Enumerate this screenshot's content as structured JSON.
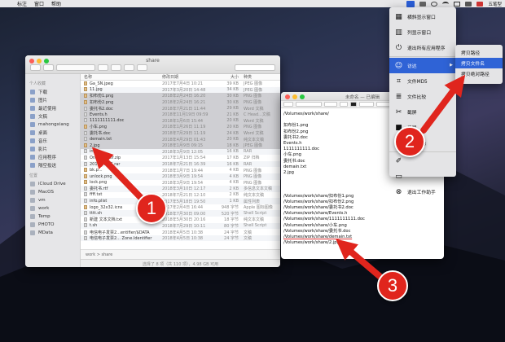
{
  "menubar": {
    "items": [
      "",
      "标注",
      "窗口",
      "帮助"
    ],
    "tray_text": "五笔型"
  },
  "finder": {
    "title": "share",
    "sidebar": {
      "favorites_head": "个人收藏",
      "favorites": [
        "下载",
        "图片",
        "最近使用",
        "文稿",
        "mahongxiang",
        "桌面",
        "音乐",
        "影片",
        "应用程序",
        "隔空投送"
      ],
      "locations_head": "位置",
      "locations": [
        "iCloud Drive",
        "MacOS",
        "vm",
        "work",
        "Temp",
        "PHOTO",
        "MData"
      ]
    },
    "columns": {
      "name": "名称",
      "date": "修改日期",
      "size": "大小",
      "kind": "种类"
    },
    "rows": [
      {
        "name": "Ga_SN.jpeg",
        "date": "2017年7月4日 10:21",
        "size": "39 KB",
        "kind": "JPEG 图像",
        "icon": "img"
      },
      {
        "name": "11.jpg",
        "date": "2017年3月20日 14:48",
        "size": "34 KB",
        "kind": "JPEG 图像",
        "icon": "img"
      },
      {
        "name": "扣布份1.png",
        "date": "2018年2月24日 16:20",
        "size": "30 KB",
        "kind": "PNG 图像",
        "icon": "img"
      },
      {
        "name": "扣布份2.png",
        "date": "2018年2月24日 16:21",
        "size": "30 KB",
        "kind": "PNG 图像",
        "icon": "img"
      },
      {
        "name": "委托书2.doc",
        "date": "2018年7月21日 11:44",
        "size": "29 KB",
        "kind": "Word 文稿",
        "icon": "doc"
      },
      {
        "name": "Events.h",
        "date": "2018年11月19日 09:59",
        "size": "21 KB",
        "kind": "C Head...文稿",
        "icon": "doc"
      },
      {
        "name": "1111111111.doc",
        "date": "2018年1月6日 15:44",
        "size": "20 KB",
        "kind": "Word 文稿",
        "icon": "doc"
      },
      {
        "name": "小车.png",
        "date": "2018年1月26日 11:19",
        "size": "20 KB",
        "kind": "PNG 图像",
        "icon": "img"
      },
      {
        "name": "委托书.doc",
        "date": "2018年7月29日 11:19",
        "size": "24 KB",
        "kind": "Word 文稿",
        "icon": "doc"
      },
      {
        "name": "demain.txt",
        "date": "2018年4月29日 01:43",
        "size": "20 KB",
        "kind": "纯文本文稿",
        "icon": "doc"
      },
      {
        "name": "2.jpg",
        "date": "2018年1月9日 09:15",
        "size": "18 KB",
        "kind": "JPEG 图像",
        "icon": "img"
      },
      {
        "name": "inpu...",
        "date": "2018年3月9日 12:05",
        "size": "16 KB",
        "kind": "RAR",
        "icon": "doc"
      },
      {
        "name": "Ori...master.zip",
        "date": "2017年1月13日 15:54",
        "size": "17 KB",
        "kind": "ZIP 归档",
        "icon": "doc"
      },
      {
        "name": "201...7.876.rar",
        "date": "2018年7月21日 16:39",
        "size": "16 KB",
        "kind": "RAR",
        "icon": "doc"
      },
      {
        "name": "bk.p...",
        "date": "2018年1月7日 19:44",
        "size": "4 KB",
        "kind": "PNG 图像",
        "icon": "img"
      },
      {
        "name": "unlock.png",
        "date": "2018年3月9日 19:54",
        "size": "4 KB",
        "kind": "PNG 图像",
        "icon": "img"
      },
      {
        "name": "lock.png",
        "date": "2018年3月9日 19:54",
        "size": "4 KB",
        "kind": "PNG 图像",
        "icon": "img"
      },
      {
        "name": "委托书.rtf",
        "date": "2018年3月10日 12:17",
        "size": "2 KB",
        "kind": "多信息文本文稿",
        "icon": "doc"
      },
      {
        "name": "ffff.txt",
        "date": "2018年7月21日 12:10",
        "size": "2 KB",
        "kind": "纯文本文稿",
        "icon": "doc"
      },
      {
        "name": "info.plist",
        "date": "2017年5月18日 19:50",
        "size": "1 KB",
        "kind": "属性列表",
        "icon": "doc"
      },
      {
        "name": "logo_32x32.icns",
        "date": "2017年2月4日 16:44",
        "size": "948 字节",
        "kind": "Apple 图标图像",
        "icon": "img"
      },
      {
        "name": "tttt.sh",
        "date": "2018年7月30日 09:00",
        "size": "520 字节",
        "kind": "Shell Script",
        "icon": "doc"
      },
      {
        "name": "新建 文本文档.txt",
        "date": "2018年5月30日 20:16",
        "size": "18 字节",
        "kind": "纯文本文稿",
        "icon": "doc"
      },
      {
        "name": "t.sh",
        "date": "2018年7月29日 10:11",
        "size": "80 字节",
        "kind": "Shell Script",
        "icon": "doc"
      },
      {
        "name": "电信电子发票2...entifier/$DATA",
        "date": "2018年4月5日 10:38",
        "size": "24 字节",
        "kind": "文稿",
        "icon": "doc"
      },
      {
        "name": "电信电子发票2... Zone.Identifier",
        "date": "2018年4月5日 10:38",
        "size": "24 字节",
        "kind": "文稿",
        "icon": "doc"
      }
    ],
    "path": "work  >  share",
    "status": "选择了 8 项（共 110 项），4.98 GB 可用"
  },
  "editor": {
    "title": "未命名 — 已编辑",
    "lines": [
      "/Volumes/work/share/",
      "",
      "扣布份1.png",
      "扣布份2.png",
      "委托书2.doc",
      "Events.h",
      "1111111111.doc",
      "小车.png",
      "委托书.doc",
      "demain.txt",
      "2.jpg",
      "",
      "",
      "",
      "/Volumes/work/share/扣布份1.png",
      "/Volumes/work/share/扣布份2.png",
      "/Volumes/work/share/委托书2.doc",
      "/Volumes/work/share/Events.h",
      "/Volumes/work/share/1111111111.doc",
      "/Volumes/work/share/小车.png",
      "/Volumes/work/share/委托书.doc",
      "/Volumes/work/share/demain.txt",
      "/Volumes/work/share/2.jpg"
    ]
  },
  "menu": {
    "items": [
      {
        "label": "横斜显示窗口",
        "icon": "grid-icon"
      },
      {
        "label": "列显示窗口",
        "icon": "columns-icon"
      },
      {
        "label": "退出所有应用程序",
        "icon": "power-icon"
      },
      {
        "label": "访达",
        "icon": "finder-icon",
        "submenu": true,
        "selected": true
      },
      {
        "label": "文件MD5",
        "icon": "md5-icon"
      },
      {
        "label": "文件比较",
        "icon": "compare-icon"
      },
      {
        "label": "截屏",
        "icon": "scissors-icon"
      },
      {
        "label": "录屏",
        "icon": "camera-icon"
      },
      {
        "label": "吸取颜色",
        "icon": "eyedropper-icon"
      },
      {
        "label": "",
        "icon": "pencil-icon"
      },
      {
        "label": "",
        "icon": "monitor-icon"
      },
      {
        "label": "退出工作助手",
        "icon": "quit-icon"
      }
    ],
    "submenu": [
      {
        "label": "拷贝路径",
        "selected": false
      },
      {
        "label": "拷贝文件名",
        "selected": true
      },
      {
        "label": "拷贝绝对路径",
        "selected": false
      }
    ]
  },
  "annotations": {
    "badge1": "1",
    "badge2": "2",
    "badge3": "3",
    "color": "#e0251d"
  }
}
